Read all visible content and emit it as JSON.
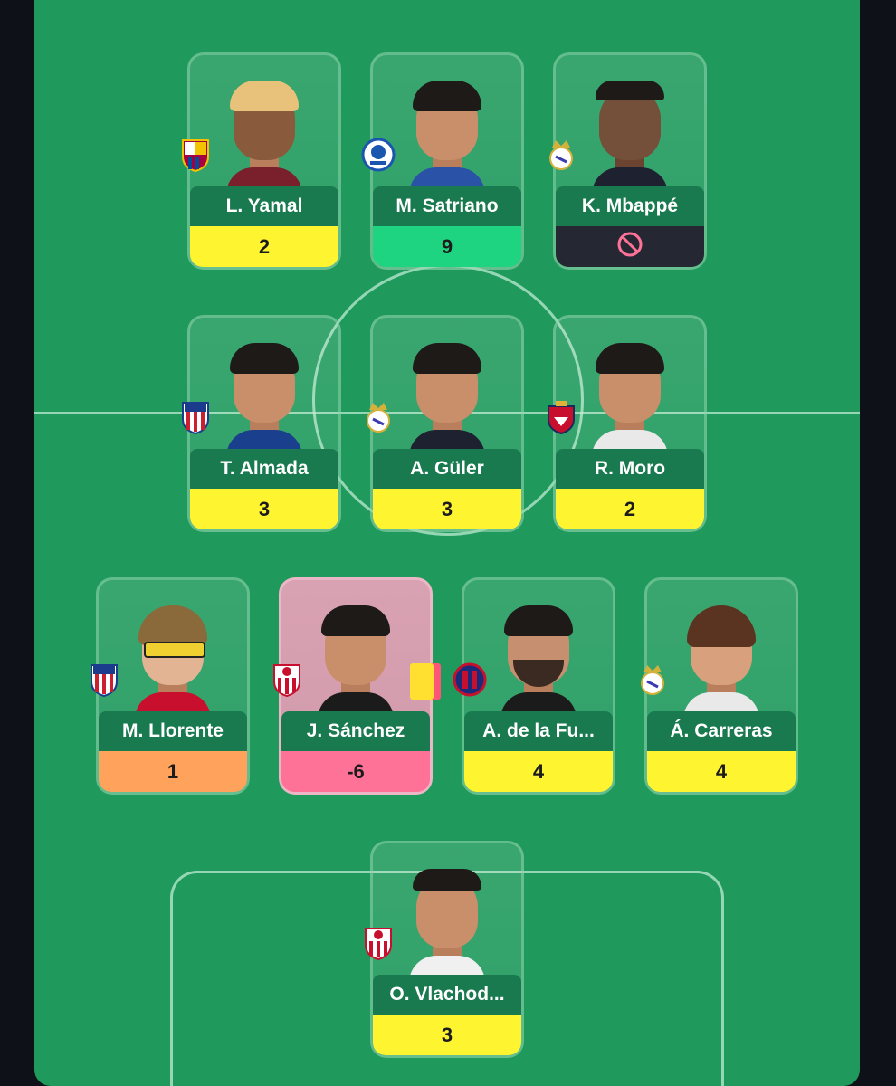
{
  "colors": {
    "pitch": "#1f9a5c",
    "name_bar": "#197a4f",
    "points_default": "#fff430",
    "points_high": "#1ed481",
    "points_low": "#ffa35c",
    "points_negative": "#ff7298",
    "points_blocked": "#252832"
  },
  "players": [
    {
      "name": "L. Yamal",
      "points": "2",
      "club_crest": "barcelona-crest-icon"
    },
    {
      "name": "M. Satriano",
      "points": "9",
      "club_crest": "getafe-crest-icon"
    },
    {
      "name": "K. Mbappé",
      "points": "",
      "club_crest": "real-madrid-crest-icon",
      "status_icon": "prohibited-icon"
    },
    {
      "name": "T. Almada",
      "points": "3",
      "club_crest": "atletico-madrid-crest-icon"
    },
    {
      "name": "A. Güler",
      "points": "3",
      "club_crest": "real-madrid-crest-icon"
    },
    {
      "name": "R. Moro",
      "points": "2",
      "club_crest": "osasuna-crest-icon"
    },
    {
      "name": "M. Llorente",
      "points": "1",
      "club_crest": "atletico-madrid-crest-icon"
    },
    {
      "name": "J. Sánchez",
      "points": "-6",
      "club_crest": "sevilla-crest-icon",
      "card_icon": "yellow-red-card-icon"
    },
    {
      "name": "A. de la Fu...",
      "points": "4",
      "club_crest": "levante-crest-icon"
    },
    {
      "name": "Á. Carreras",
      "points": "4",
      "club_crest": "real-madrid-crest-icon"
    },
    {
      "name": "O. Vlachod...",
      "points": "3",
      "club_crest": "sevilla-crest-icon"
    }
  ]
}
